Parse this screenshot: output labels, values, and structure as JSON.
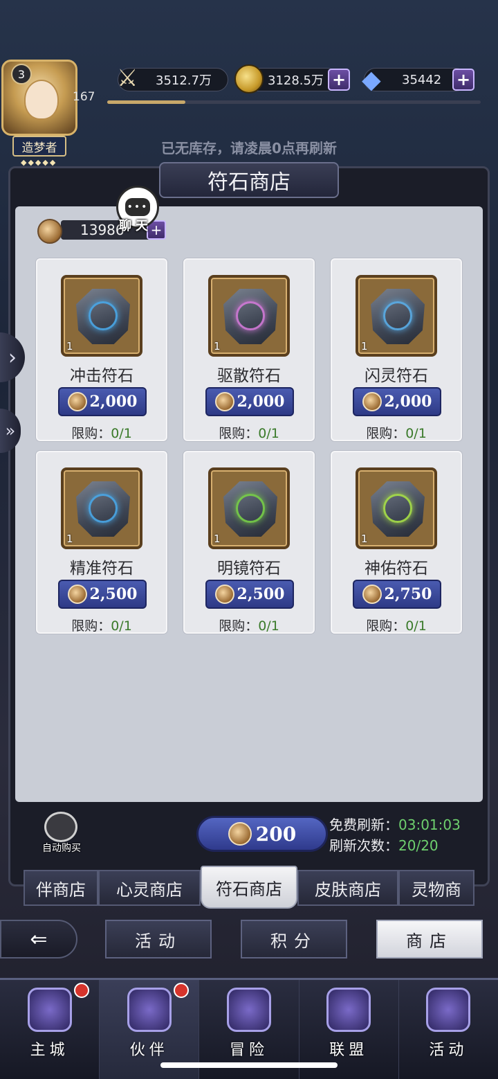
{
  "player": {
    "level": "3",
    "title": "造梦者",
    "stars": "◆◆◆◆◆",
    "number": "167"
  },
  "resources": {
    "power": "3512.7万",
    "gold": "3128.5万",
    "diamonds": "35442",
    "plus_symbol": "+"
  },
  "notice": "已无库存，请凌晨0点再刷新",
  "shop": {
    "title": "符石商店",
    "currency_amount": "13986",
    "chat_label": "聊天",
    "chat_bubble": "•••",
    "limit_label": "限购：",
    "items": [
      {
        "name": "冲击符石",
        "price": "2,000",
        "qty": "1",
        "limit": "0/1",
        "glyph_color": "#4aa8e8"
      },
      {
        "name": "驱散符石",
        "price": "2,000",
        "qty": "1",
        "limit": "0/1",
        "glyph_color": "#d27ad8"
      },
      {
        "name": "闪灵符石",
        "price": "2,000",
        "qty": "1",
        "limit": "0/1",
        "glyph_color": "#5aaee8"
      },
      {
        "name": "精准符石",
        "price": "2,500",
        "qty": "1",
        "limit": "0/1",
        "glyph_color": "#4aa8e8"
      },
      {
        "name": "明镜符石",
        "price": "2,500",
        "qty": "1",
        "limit": "0/1",
        "glyph_color": "#78d048"
      },
      {
        "name": "神佑符石",
        "price": "2,750",
        "qty": "1",
        "limit": "0/1",
        "glyph_color": "#a8e048"
      }
    ],
    "auto_buy_label": "自动购买",
    "refresh_cost": "200",
    "free_refresh_label": "免费刷新：",
    "free_refresh_time": "03:01:03",
    "refresh_count_label": "刷新次数：",
    "refresh_count": "20/20"
  },
  "shop_tabs": [
    "伴商店",
    "心灵商店",
    "符石商店",
    "皮肤商店",
    "灵物商"
  ],
  "active_shop_tab": 2,
  "categories": [
    "活动",
    "积分",
    "商店"
  ],
  "active_category": 2,
  "nav": [
    {
      "label": "主城",
      "badge": true
    },
    {
      "label": "伙伴",
      "badge": true
    },
    {
      "label": "冒险",
      "badge": false
    },
    {
      "label": "联盟",
      "badge": false
    },
    {
      "label": "活动",
      "badge": false
    }
  ],
  "active_nav": 1,
  "exp_progress": 0.21
}
